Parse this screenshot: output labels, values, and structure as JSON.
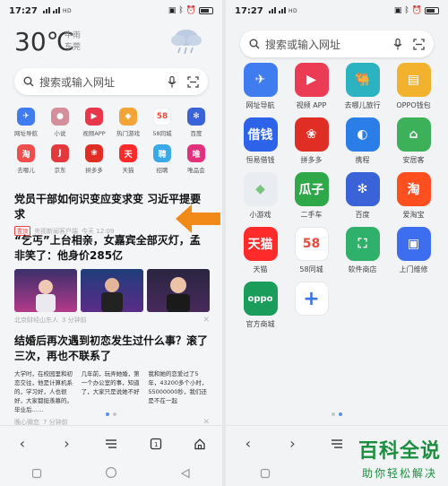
{
  "left": {
    "status": {
      "time": "17:27",
      "net": "ᴴᴰ ᴴᴰ HDᵢ",
      "battery_icon": "battery-icon"
    },
    "weather": {
      "temp": "30℃",
      "desc": "中雨",
      "city": "东莞"
    },
    "search": {
      "placeholder": "搜索或输入网址"
    },
    "quick_links": [
      {
        "label": "网址导航",
        "color": "#3f7cf0",
        "glyph": "✈"
      },
      {
        "label": "小说",
        "color": "#d58f9a",
        "glyph": "●"
      },
      {
        "label": "视频APP",
        "color": "#e8374b",
        "glyph": "▶"
      },
      {
        "label": "热门游戏",
        "color": "#f2a436",
        "glyph": "◆"
      },
      {
        "label": "58同城",
        "color": "#ffffff",
        "glyph": "58"
      },
      {
        "label": "百度",
        "color": "#3a63d8",
        "glyph": "✻"
      },
      {
        "label": "去哪儿",
        "color": "#f04d4d",
        "glyph": "淘"
      },
      {
        "label": "京东",
        "color": "#e4393c",
        "glyph": "J"
      },
      {
        "label": "拼多多",
        "color": "#e02e24",
        "glyph": "❀"
      },
      {
        "label": "天猫",
        "color": "#ff2b2b",
        "glyph": "天"
      },
      {
        "label": "招聘",
        "color": "#3aa9e8",
        "glyph": "聘"
      },
      {
        "label": "唯品会",
        "color": "#e3307a",
        "glyph": "唯"
      }
    ],
    "news": [
      {
        "title": "党员干部如何识变应变求变 习近平提要求",
        "tag": "置顶",
        "source": "央视新闻客户端",
        "time": "今天 12:09"
      },
      {
        "title": "“乞丐”上台相亲，女嘉宾全部灭灯，孟非笑了：他身价285亿",
        "source": "北京财经山东人",
        "time": "3 分钟前"
      },
      {
        "title": "结婚后再次遇到初恋发生过什么事？滚了三次，再也不联系了",
        "source": "晚心微恋",
        "time": "7 分钟前",
        "cols": [
          "大学时，在校园里和初恋交往，他是计算机系的，学习好，人也很好，大家都挺羡慕的。毕业后……",
          "几年前，玩弄她婚，第一个办公室的事，知道了，大家只是说她不好",
          "我和她的恋爱过了5年，43200多个小时，55000000秒，我们还是不在一起"
        ]
      }
    ]
  },
  "right": {
    "status": {
      "time": "17:27",
      "net": "ᴴᴰ ᴴᴰ HDᵢ"
    },
    "search": {
      "placeholder": "搜索或输入网址"
    },
    "apps": [
      {
        "label": "网址导航",
        "color": "#3f7cf0",
        "glyph": "✈"
      },
      {
        "label": "视频 APP",
        "color": "#ec3c55",
        "glyph": "▶"
      },
      {
        "label": "去哪儿旅行",
        "color": "#2bb3c1",
        "glyph": "🐫"
      },
      {
        "label": "OPPO钱包",
        "color": "#f2b22e",
        "glyph": "▤"
      },
      {
        "label": "恒易借钱",
        "color": "#2d63e8",
        "glyph": "借钱"
      },
      {
        "label": "拼多多",
        "color": "#e02e24",
        "glyph": "❀"
      },
      {
        "label": "携程",
        "color": "#2b7ee8",
        "glyph": "◐"
      },
      {
        "label": "安居客",
        "color": "#3cb15a",
        "glyph": "⌂"
      },
      {
        "label": "小游戏",
        "color": "#e9ecf0",
        "glyph": "◆"
      },
      {
        "label": "二手车",
        "color": "#2fa84a",
        "glyph": "瓜子"
      },
      {
        "label": "百度",
        "color": "#3a63d8",
        "glyph": "✻"
      },
      {
        "label": "爱淘宝",
        "color": "#ff4f1f",
        "glyph": "淘"
      },
      {
        "label": "天猫",
        "color": "#ff2b2b",
        "glyph": "天猫"
      },
      {
        "label": "58同城",
        "color": "#ffffff",
        "glyph": "58"
      },
      {
        "label": "软件商店",
        "color": "#2fb16c",
        "glyph": "⛶"
      },
      {
        "label": "上门维修",
        "color": "#3e6ef0",
        "glyph": "▣"
      },
      {
        "label": "官方商城",
        "color": "#1a9d5a",
        "glyph": "oppo"
      },
      {
        "label": "",
        "color": "#ffffff",
        "glyph": "+"
      }
    ]
  },
  "watermark": {
    "line1": "百科全说",
    "line2": "助你轻松解决"
  }
}
